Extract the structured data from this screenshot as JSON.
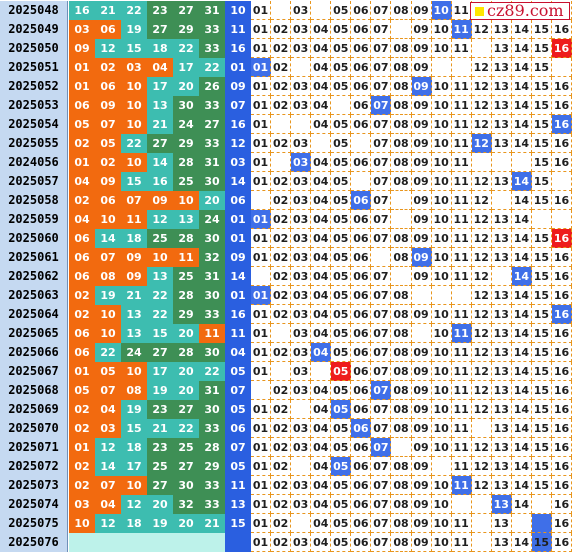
{
  "colors": {
    "zone_orange": "#f26a0f",
    "zone_teal": "#3dbdb0",
    "zone_green": "#3e8f55",
    "zone_empty": "#bdf2ea",
    "blue_ball": "#2a5fe0",
    "hit": "#3f6fe8",
    "repeat": "#ee1c1c",
    "issue_bg": "#c5d9f1",
    "grid_line": "#e8961e"
  },
  "logo": {
    "text": "cz89.com"
  },
  "rows": [
    {
      "issue": "2025048",
      "reds": [
        "16",
        "21",
        "22",
        "23",
        "27",
        "31"
      ],
      "blue": "10"
    },
    {
      "issue": "2025049",
      "reds": [
        "03",
        "06",
        "19",
        "27",
        "29",
        "33"
      ],
      "blue": "11"
    },
    {
      "issue": "2025050",
      "reds": [
        "09",
        "12",
        "15",
        "18",
        "22",
        "33"
      ],
      "blue": "16"
    },
    {
      "issue": "2025051",
      "reds": [
        "01",
        "02",
        "03",
        "04",
        "17",
        "22"
      ],
      "blue": "01"
    },
    {
      "issue": "2025052",
      "reds": [
        "01",
        "06",
        "10",
        "17",
        "20",
        "26"
      ],
      "blue": "09"
    },
    {
      "issue": "2025053",
      "reds": [
        "06",
        "09",
        "10",
        "13",
        "30",
        "33"
      ],
      "blue": "07"
    },
    {
      "issue": "2025054",
      "reds": [
        "05",
        "07",
        "10",
        "21",
        "24",
        "27"
      ],
      "blue": "16"
    },
    {
      "issue": "2025055",
      "reds": [
        "02",
        "05",
        "22",
        "27",
        "29",
        "33"
      ],
      "blue": "12"
    },
    {
      "issue": "2024056",
      "reds": [
        "01",
        "02",
        "10",
        "14",
        "28",
        "31"
      ],
      "blue": "03"
    },
    {
      "issue": "2025057",
      "reds": [
        "04",
        "09",
        "15",
        "16",
        "25",
        "30"
      ],
      "blue": "14"
    },
    {
      "issue": "2025058",
      "reds": [
        "02",
        "06",
        "07",
        "09",
        "10",
        "20"
      ],
      "blue": "06"
    },
    {
      "issue": "2025059",
      "reds": [
        "04",
        "10",
        "11",
        "12",
        "13",
        "24"
      ],
      "blue": "01"
    },
    {
      "issue": "2025060",
      "reds": [
        "06",
        "14",
        "18",
        "25",
        "28",
        "30"
      ],
      "blue": "01"
    },
    {
      "issue": "2025061",
      "reds": [
        "06",
        "07",
        "09",
        "10",
        "11",
        "32"
      ],
      "blue": "09"
    },
    {
      "issue": "2025062",
      "reds": [
        "06",
        "08",
        "09",
        "13",
        "25",
        "31"
      ],
      "blue": "14"
    },
    {
      "issue": "2025063",
      "reds": [
        "02",
        "19",
        "21",
        "22",
        "28",
        "30"
      ],
      "blue": "01"
    },
    {
      "issue": "2025064",
      "reds": [
        "02",
        "10",
        "13",
        "22",
        "29",
        "33"
      ],
      "blue": "16"
    },
    {
      "issue": "2025065",
      "reds": [
        "06",
        "10",
        "13",
        "15",
        "20",
        "11"
      ],
      "blue": "11"
    },
    {
      "issue": "2025066",
      "reds": [
        "06",
        "22",
        "24",
        "27",
        "28",
        "30"
      ],
      "blue": "04"
    },
    {
      "issue": "2025067",
      "reds": [
        "01",
        "05",
        "10",
        "17",
        "20",
        "22"
      ],
      "blue": "05"
    },
    {
      "issue": "2025068",
      "reds": [
        "05",
        "07",
        "08",
        "19",
        "20",
        "31"
      ],
      "blue": "07"
    },
    {
      "issue": "2025069",
      "reds": [
        "02",
        "04",
        "19",
        "23",
        "27",
        "30"
      ],
      "blue": "05"
    },
    {
      "issue": "2025070",
      "reds": [
        "02",
        "03",
        "15",
        "21",
        "22",
        "33"
      ],
      "blue": "06"
    },
    {
      "issue": "2025071",
      "reds": [
        "01",
        "12",
        "18",
        "23",
        "25",
        "28"
      ],
      "blue": "07"
    },
    {
      "issue": "2025072",
      "reds": [
        "02",
        "14",
        "17",
        "25",
        "27",
        "29"
      ],
      "blue": "05"
    },
    {
      "issue": "2025073",
      "reds": [
        "02",
        "07",
        "10",
        "27",
        "30",
        "33"
      ],
      "blue": "11"
    },
    {
      "issue": "2025074",
      "reds": [
        "03",
        "04",
        "12",
        "20",
        "32",
        "33"
      ],
      "blue": "13"
    },
    {
      "issue": "2025075",
      "reds": [
        "10",
        "12",
        "18",
        "19",
        "20",
        "21"
      ],
      "blue": "15"
    },
    {
      "issue": "2025076",
      "reds": [
        "",
        "",
        "",
        "",
        "",
        ""
      ],
      "blue": ""
    }
  ],
  "trend": [
    [
      "01",
      "",
      "03",
      "",
      "05",
      "06",
      "07",
      "08",
      "09",
      "10",
      "11",
      "",
      "",
      "",
      "",
      ""
    ],
    [
      "01",
      "02",
      "03",
      "04",
      "05",
      "06",
      "07",
      "",
      "09",
      "10",
      "11",
      "12",
      "13",
      "14",
      "15",
      "16"
    ],
    [
      "01",
      "02",
      "03",
      "04",
      "05",
      "06",
      "07",
      "08",
      "09",
      "10",
      "11",
      "",
      "13",
      "14",
      "15",
      "16"
    ],
    [
      "01",
      "02",
      "",
      "04",
      "05",
      "06",
      "07",
      "08",
      "09",
      "",
      "",
      "12",
      "13",
      "14",
      "15",
      ""
    ],
    [
      "01",
      "02",
      "03",
      "04",
      "05",
      "06",
      "07",
      "08",
      "09",
      "10",
      "11",
      "12",
      "13",
      "14",
      "15",
      "16"
    ],
    [
      "01",
      "02",
      "03",
      "04",
      "",
      "06",
      "07",
      "08",
      "09",
      "10",
      "11",
      "12",
      "13",
      "14",
      "15",
      "16"
    ],
    [
      "01",
      "",
      "",
      "04",
      "05",
      "06",
      "07",
      "08",
      "09",
      "10",
      "11",
      "12",
      "13",
      "14",
      "15",
      "16"
    ],
    [
      "01",
      "02",
      "03",
      "",
      "05",
      "",
      "07",
      "08",
      "09",
      "10",
      "11",
      "12",
      "13",
      "14",
      "15",
      "16"
    ],
    [
      "01",
      "",
      "03",
      "04",
      "05",
      "06",
      "07",
      "08",
      "09",
      "10",
      "11",
      "",
      "",
      "",
      "15",
      "16"
    ],
    [
      "01",
      "02",
      "03",
      "04",
      "05",
      "",
      "07",
      "08",
      "09",
      "10",
      "11",
      "12",
      "13",
      "14",
      "15",
      ""
    ],
    [
      "",
      "02",
      "03",
      "04",
      "05",
      "06",
      "07",
      "",
      "09",
      "10",
      "11",
      "12",
      "",
      "14",
      "15",
      "16"
    ],
    [
      "01",
      "02",
      "03",
      "04",
      "05",
      "06",
      "07",
      "",
      "09",
      "10",
      "11",
      "12",
      "13",
      "14",
      "",
      ""
    ],
    [
      "01",
      "02",
      "03",
      "04",
      "05",
      "06",
      "07",
      "08",
      "09",
      "10",
      "11",
      "12",
      "13",
      "14",
      "15",
      "16"
    ],
    [
      "01",
      "02",
      "03",
      "04",
      "05",
      "06",
      "",
      "08",
      "09",
      "10",
      "11",
      "12",
      "13",
      "14",
      "15",
      "16"
    ],
    [
      "",
      "02",
      "03",
      "04",
      "05",
      "06",
      "07",
      "",
      "09",
      "10",
      "11",
      "12",
      "",
      "14",
      "15",
      "16"
    ],
    [
      "01",
      "02",
      "03",
      "04",
      "05",
      "06",
      "07",
      "08",
      "",
      "",
      "",
      "12",
      "13",
      "14",
      "15",
      "16"
    ],
    [
      "01",
      "02",
      "03",
      "04",
      "05",
      "06",
      "07",
      "08",
      "09",
      "10",
      "11",
      "12",
      "13",
      "14",
      "15",
      "16"
    ],
    [
      "01",
      "",
      "03",
      "04",
      "05",
      "06",
      "07",
      "08",
      "",
      "10",
      "11",
      "12",
      "13",
      "14",
      "15",
      "16"
    ],
    [
      "01",
      "02",
      "03",
      "04",
      "05",
      "06",
      "07",
      "08",
      "09",
      "10",
      "11",
      "12",
      "13",
      "14",
      "15",
      "16"
    ],
    [
      "01",
      "",
      "03",
      "",
      "05",
      "06",
      "07",
      "08",
      "09",
      "10",
      "11",
      "12",
      "13",
      "14",
      "15",
      "16"
    ],
    [
      "",
      "02",
      "03",
      "04",
      "05",
      "06",
      "07",
      "08",
      "09",
      "10",
      "11",
      "12",
      "13",
      "14",
      "15",
      "16"
    ],
    [
      "01",
      "02",
      "",
      "04",
      "05",
      "06",
      "07",
      "08",
      "09",
      "10",
      "11",
      "12",
      "13",
      "14",
      "15",
      "16"
    ],
    [
      "01",
      "02",
      "03",
      "04",
      "05",
      "06",
      "07",
      "08",
      "09",
      "10",
      "11",
      "",
      "13",
      "14",
      "15",
      "16"
    ],
    [
      "01",
      "02",
      "03",
      "04",
      "05",
      "06",
      "07",
      "",
      "09",
      "10",
      "11",
      "12",
      "13",
      "14",
      "15",
      "16"
    ],
    [
      "01",
      "02",
      "",
      "04",
      "05",
      "06",
      "07",
      "08",
      "09",
      "",
      "11",
      "12",
      "13",
      "14",
      "15",
      "16"
    ],
    [
      "01",
      "02",
      "03",
      "04",
      "05",
      "06",
      "07",
      "08",
      "09",
      "10",
      "11",
      "12",
      "13",
      "14",
      "15",
      "16"
    ],
    [
      "01",
      "02",
      "03",
      "04",
      "05",
      "06",
      "07",
      "08",
      "09",
      "10",
      "",
      "",
      "13",
      "14",
      "",
      "16"
    ],
    [
      "01",
      "02",
      "",
      "04",
      "05",
      "06",
      "07",
      "08",
      "09",
      "10",
      "11",
      "",
      "13",
      "",
      "",
      "16"
    ],
    [
      "01",
      "02",
      "03",
      "04",
      "05",
      "06",
      "07",
      "08",
      "09",
      "10",
      "11",
      "",
      "13",
      "14",
      "15",
      "16"
    ]
  ],
  "hits": [
    {
      "row": 0,
      "col": 9,
      "kind": "hit"
    },
    {
      "row": 1,
      "col": 10,
      "kind": "hit"
    },
    {
      "row": 2,
      "col": 15,
      "kind": "dup"
    },
    {
      "row": 3,
      "col": 0,
      "kind": "hit"
    },
    {
      "row": 4,
      "col": 8,
      "kind": "hit"
    },
    {
      "row": 5,
      "col": 6,
      "kind": "hit"
    },
    {
      "row": 6,
      "col": 15,
      "kind": "hit"
    },
    {
      "row": 7,
      "col": 11,
      "kind": "hit"
    },
    {
      "row": 8,
      "col": 2,
      "kind": "hit"
    },
    {
      "row": 9,
      "col": 13,
      "kind": "hit"
    },
    {
      "row": 10,
      "col": 5,
      "kind": "hit"
    },
    {
      "row": 11,
      "col": 0,
      "kind": "hit"
    },
    {
      "row": 12,
      "col": 15,
      "kind": "dup"
    },
    {
      "row": 13,
      "col": 8,
      "kind": "hit"
    },
    {
      "row": 14,
      "col": 13,
      "kind": "hit"
    },
    {
      "row": 15,
      "col": 0,
      "kind": "hit"
    },
    {
      "row": 16,
      "col": 15,
      "kind": "hit"
    },
    {
      "row": 17,
      "col": 10,
      "kind": "hit"
    },
    {
      "row": 18,
      "col": 3,
      "kind": "hit"
    },
    {
      "row": 19,
      "col": 4,
      "kind": "dup"
    },
    {
      "row": 20,
      "col": 6,
      "kind": "hit"
    },
    {
      "row": 21,
      "col": 4,
      "kind": "hit"
    },
    {
      "row": 22,
      "col": 5,
      "kind": "hit"
    },
    {
      "row": 23,
      "col": 6,
      "kind": "hit"
    },
    {
      "row": 24,
      "col": 4,
      "kind": "hit"
    },
    {
      "row": 25,
      "col": 10,
      "kind": "hit"
    },
    {
      "row": 26,
      "col": 12,
      "kind": "hit"
    },
    {
      "row": 27,
      "col": 14,
      "kind": "hit"
    },
    {
      "row": 28,
      "col": 14,
      "kind": "cur"
    }
  ]
}
